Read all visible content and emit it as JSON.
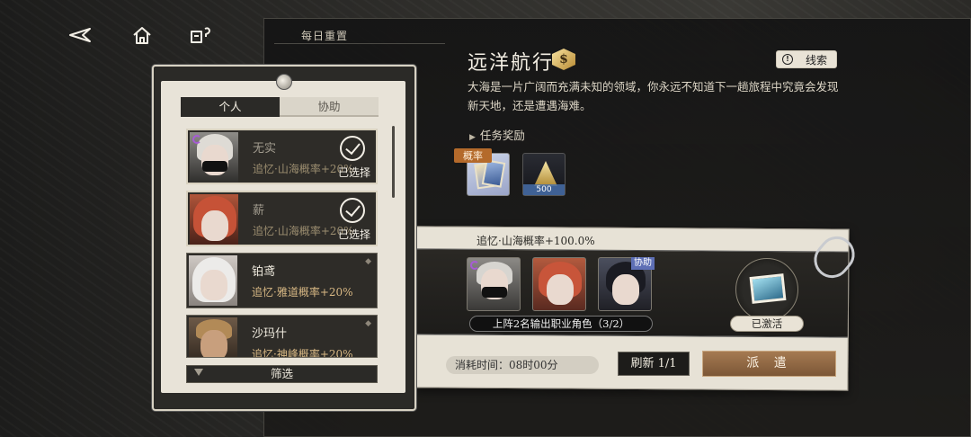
{
  "nav": {
    "back_icon": "back-arrow-icon",
    "home_icon": "home-icon",
    "help_icon": "help-icon"
  },
  "mission": {
    "daily_reset": "每日重置",
    "title": "远洋航行",
    "badge_symbol": "$",
    "clue_label": "线索",
    "description": "大海是一片广阔而充满未知的领域，你永远不知道下一趟旅程中究竟会发现新天地，还是遭遇海难。",
    "reward_label": "任务奖励",
    "rewards": [
      {
        "tag": "概率",
        "icon": "memory-card-icon"
      },
      {
        "count": "500",
        "icon": "gold-pile-icon"
      }
    ]
  },
  "dispatch": {
    "bonus_text": "追忆·山海概率+100.0%",
    "assist_tag": "协助",
    "class_requirement": "上阵2名输出职业角色（3/2）",
    "activated_label": "已激活",
    "cost_time": "消耗时间：08时00分",
    "refresh_label": "刷新 1/1",
    "dispatch_label": "派 遣"
  },
  "roster": {
    "tabs": [
      {
        "label": "个人",
        "active": true
      },
      {
        "label": "协助",
        "active": false
      }
    ],
    "selected_text": "已选择",
    "rows": [
      {
        "name": "无实",
        "bonus": "追忆·山海概率+20%",
        "selected": true
      },
      {
        "name": "薪",
        "bonus": "追忆·山海概率+20%",
        "selected": true
      },
      {
        "name": "铂鸢",
        "bonus": "追忆·雅道概率+20%",
        "selected": false
      },
      {
        "name": "沙玛什",
        "bonus": "追忆·神峰概率+20%",
        "selected": false
      }
    ],
    "filter_label": "筛选"
  },
  "colors": {
    "accent_gold": "#d8b884",
    "dispatch_button": "#a57a52",
    "assist_blue": "#5e6fb5",
    "probability_tag": "#b46a2b"
  }
}
